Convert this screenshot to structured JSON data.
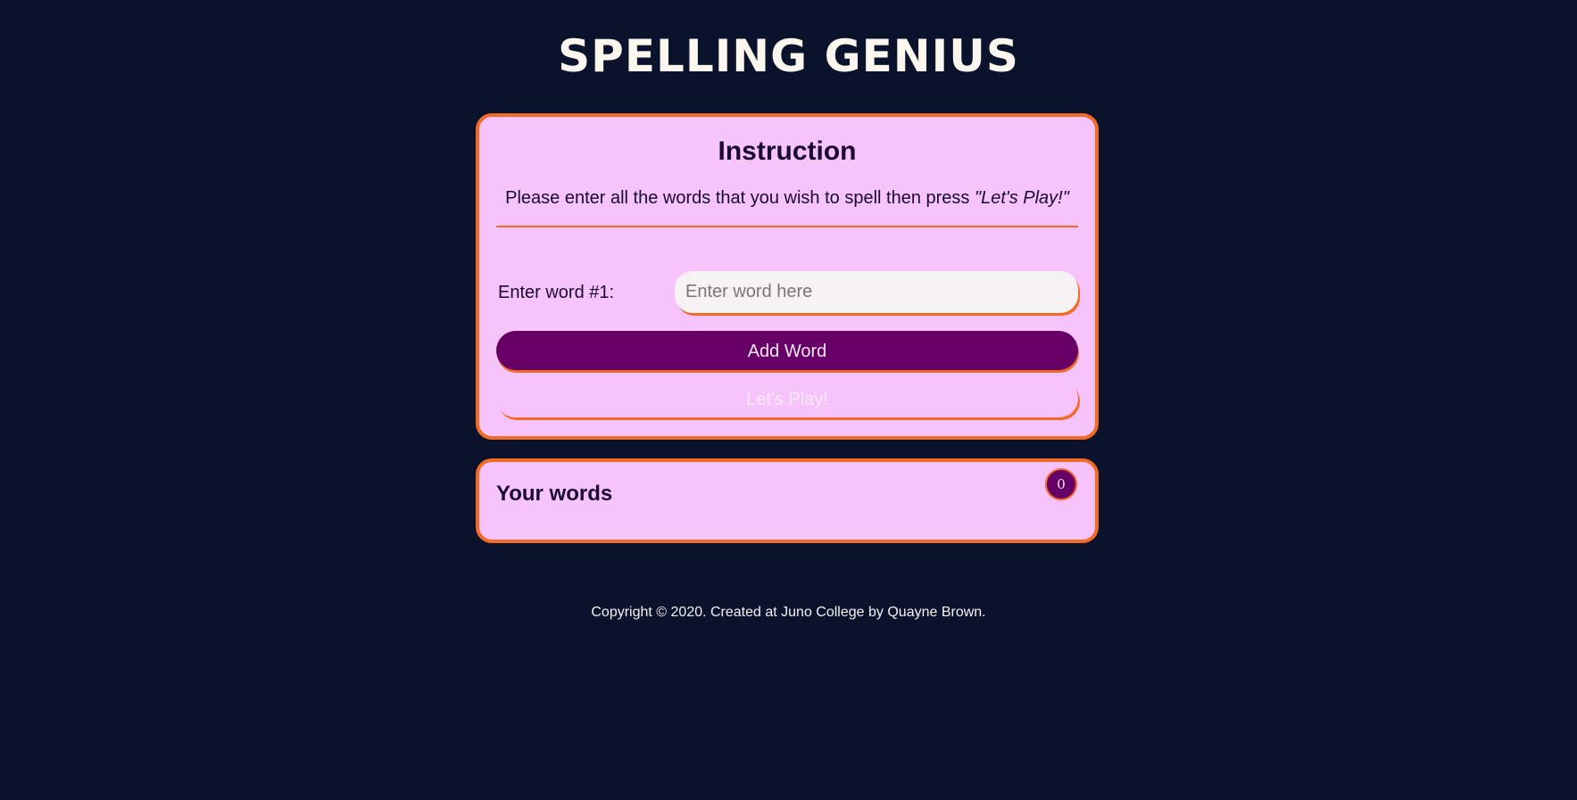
{
  "header": {
    "title": "SPELLING GENIUS"
  },
  "instructions": {
    "heading": "Instruction",
    "text": "Please enter all the words that you wish to spell then press",
    "text_emphasis": "\"Let's Play!\""
  },
  "word_entry": {
    "label": "Enter word #1:",
    "placeholder": "Enter word here",
    "value": ""
  },
  "buttons": {
    "add_word": "Add Word",
    "lets_play": "Let's Play!"
  },
  "words_panel": {
    "heading": "Your words",
    "count": "0"
  },
  "footer": {
    "copyright": "Copyright © 2020. Created at Juno College by Quayne Brown."
  },
  "colors": {
    "background": "#0a132b",
    "card": "#f6c3fb",
    "accent": "#f26a24",
    "button": "#660066"
  }
}
